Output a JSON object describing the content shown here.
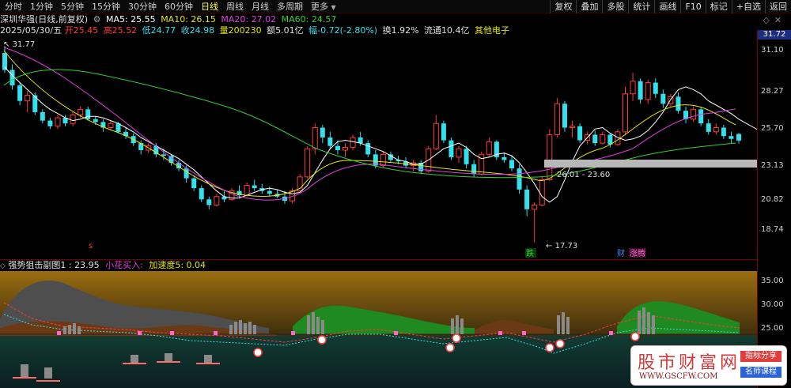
{
  "toolbar": {
    "periods": [
      "分时",
      "1分钟",
      "5分钟",
      "15分钟",
      "30分钟",
      "60分钟",
      "日线",
      "周线",
      "月线",
      "多周期",
      "更多"
    ],
    "active_period": "日线",
    "tools": [
      "复权",
      "叠加",
      "多股",
      "统计",
      "画线",
      "F10",
      "标记",
      "+自选",
      "返回"
    ]
  },
  "stock": {
    "name": "深圳华强(日线,前复权)",
    "date": "2025/05/30/五",
    "open": "开25.45",
    "high": "高25.52",
    "low": "低24.77",
    "close": "收24.98",
    "volume": "量200230",
    "amount": "额5.01亿",
    "change": "幅-0.72(-2.80%)",
    "turnover": "换1.92%",
    "float_cap": "流通10.4亿",
    "sector": "其他电子"
  },
  "ma": {
    "ma5": "MA5: 25.55",
    "ma10": "MA10: 26.15",
    "ma20": "MA20: 27.02",
    "ma60": "MA60: 24.57"
  },
  "colors": {
    "up": "#ff3a3a",
    "down": "#33e0ee",
    "ma5": "#ffffff",
    "ma10": "#e6e600",
    "ma20": "#e040e0",
    "ma60": "#33d033",
    "axis": "#7a0000"
  },
  "price_axis": {
    "badge": "31.72",
    "ticks": [
      "31.10",
      "28.27",
      "25.70",
      "23.13",
      "20.82",
      "18.74"
    ]
  },
  "annotations": {
    "high_label": "31.77",
    "low_label": "17.73",
    "range_label": "26.01 - 23.60",
    "tag_die": "跌",
    "tag_cai": "财",
    "tag_zhangteng": "涨腾",
    "tag_s": "s"
  },
  "sub_panel": {
    "title": "强势狙击副图1",
    "value": ": 23.95",
    "xiaohua": "小花买入:",
    "accel": "加速度5: 0.04",
    "ticks": [
      "35.00",
      "30.00",
      "25.00"
    ]
  },
  "watermark": {
    "title": "股市财富网",
    "url": "WWW.GSCFW.COM",
    "tag1": "指标分享",
    "tag2": "名师课程"
  },
  "chart_data": {
    "type": "candlestick",
    "y_range": [
      17.0,
      32.5
    ],
    "y_ticks": [
      31.1,
      28.27,
      25.7,
      23.13,
      20.82,
      18.74
    ],
    "candles": [
      [
        31.2,
        31.7,
        29.8,
        30.0
      ],
      [
        30.0,
        30.4,
        28.6,
        28.9
      ],
      [
        28.9,
        29.1,
        27.5,
        27.8
      ],
      [
        27.8,
        28.5,
        27.0,
        28.2
      ],
      [
        28.2,
        28.4,
        26.8,
        27.0
      ],
      [
        27.0,
        27.2,
        26.2,
        26.4
      ],
      [
        26.4,
        26.6,
        25.8,
        26.0
      ],
      [
        26.0,
        26.8,
        25.8,
        26.6
      ],
      [
        26.6,
        26.8,
        26.0,
        26.2
      ],
      [
        26.2,
        27.0,
        26.0,
        26.8
      ],
      [
        26.8,
        27.4,
        26.6,
        27.2
      ],
      [
        27.2,
        27.4,
        26.4,
        26.5
      ],
      [
        26.5,
        26.7,
        26.1,
        26.3
      ],
      [
        26.3,
        26.5,
        25.6,
        25.9
      ],
      [
        25.9,
        26.4,
        25.7,
        26.2
      ],
      [
        26.2,
        26.3,
        25.5,
        25.6
      ],
      [
        25.6,
        25.9,
        25.1,
        25.3
      ],
      [
        25.3,
        25.5,
        24.6,
        24.8
      ],
      [
        24.8,
        25.0,
        24.0,
        24.3
      ],
      [
        24.3,
        24.8,
        24.1,
        24.6
      ],
      [
        24.6,
        24.8,
        23.8,
        24.0
      ],
      [
        24.0,
        24.4,
        23.6,
        23.9
      ],
      [
        23.9,
        24.0,
        23.2,
        23.4
      ],
      [
        23.4,
        23.6,
        22.8,
        23.0
      ],
      [
        23.0,
        23.2,
        22.0,
        22.3
      ],
      [
        22.3,
        22.5,
        21.4,
        21.6
      ],
      [
        21.6,
        21.8,
        20.6,
        20.8
      ],
      [
        20.8,
        21.0,
        20.1,
        20.4
      ],
      [
        20.4,
        21.2,
        20.3,
        21.0
      ],
      [
        21.0,
        21.4,
        20.6,
        20.8
      ],
      [
        20.8,
        21.6,
        20.7,
        21.4
      ],
      [
        21.4,
        21.8,
        20.9,
        21.1
      ],
      [
        21.1,
        22.0,
        21.0,
        21.8
      ],
      [
        21.8,
        22.2,
        21.4,
        21.6
      ],
      [
        21.6,
        21.9,
        21.2,
        21.4
      ],
      [
        21.4,
        21.7,
        21.0,
        21.2
      ],
      [
        21.2,
        21.5,
        20.9,
        21.0
      ],
      [
        21.0,
        21.4,
        20.5,
        20.7
      ],
      [
        20.7,
        21.6,
        20.5,
        21.4
      ],
      [
        21.4,
        22.6,
        21.3,
        22.4
      ],
      [
        22.4,
        24.6,
        22.3,
        24.4
      ],
      [
        24.4,
        26.2,
        24.0,
        25.9
      ],
      [
        25.9,
        26.1,
        24.8,
        25.2
      ],
      [
        25.2,
        25.6,
        24.4,
        24.6
      ],
      [
        24.6,
        25.0,
        24.0,
        24.3
      ],
      [
        24.3,
        24.8,
        23.8,
        24.5
      ],
      [
        24.5,
        25.4,
        24.3,
        25.2
      ],
      [
        25.2,
        25.6,
        24.6,
        24.8
      ],
      [
        24.8,
        25.0,
        23.8,
        24.0
      ],
      [
        24.0,
        24.3,
        23.0,
        23.2
      ],
      [
        23.2,
        24.2,
        23.1,
        24.0
      ],
      [
        24.0,
        24.2,
        23.4,
        23.6
      ],
      [
        23.6,
        23.9,
        23.3,
        23.5
      ],
      [
        23.5,
        23.8,
        23.0,
        23.2
      ],
      [
        23.2,
        23.6,
        22.8,
        23.4
      ],
      [
        23.4,
        23.6,
        22.6,
        22.8
      ],
      [
        22.8,
        24.6,
        22.7,
        24.4
      ],
      [
        24.4,
        26.8,
        24.3,
        26.2
      ],
      [
        26.2,
        26.4,
        24.8,
        25.0
      ],
      [
        25.0,
        25.2,
        23.6,
        23.8
      ],
      [
        23.8,
        24.6,
        23.4,
        24.4
      ],
      [
        24.4,
        24.6,
        23.0,
        23.3
      ],
      [
        23.3,
        23.6,
        22.4,
        22.6
      ],
      [
        22.6,
        24.2,
        22.5,
        24.0
      ],
      [
        24.0,
        25.2,
        23.8,
        24.9
      ],
      [
        24.9,
        25.0,
        23.6,
        23.8
      ],
      [
        23.8,
        24.1,
        23.4,
        23.6
      ],
      [
        23.6,
        23.9,
        22.8,
        23.0
      ],
      [
        23.0,
        23.3,
        21.2,
        21.5
      ],
      [
        21.5,
        21.8,
        19.6,
        20.1
      ],
      [
        20.1,
        20.6,
        17.73,
        20.4
      ],
      [
        20.4,
        22.4,
        20.3,
        22.2
      ],
      [
        22.2,
        25.8,
        22.1,
        25.4
      ],
      [
        25.4,
        28.0,
        25.2,
        27.6
      ],
      [
        27.6,
        27.8,
        25.6,
        25.9
      ],
      [
        25.9,
        26.4,
        25.2,
        26.0
      ],
      [
        26.0,
        26.2,
        24.8,
        25.0
      ],
      [
        25.0,
        25.6,
        24.7,
        25.4
      ],
      [
        25.4,
        25.7,
        24.6,
        24.8
      ],
      [
        24.8,
        25.6,
        24.7,
        25.4
      ],
      [
        25.4,
        25.5,
        24.5,
        24.7
      ],
      [
        24.7,
        25.8,
        24.6,
        25.6
      ],
      [
        25.6,
        28.8,
        25.4,
        28.3
      ],
      [
        28.3,
        29.8,
        27.8,
        29.2
      ],
      [
        29.2,
        29.4,
        27.6,
        27.9
      ],
      [
        27.9,
        29.3,
        27.6,
        29.1
      ],
      [
        29.1,
        29.4,
        28.0,
        28.3
      ],
      [
        28.3,
        28.6,
        27.3,
        27.6
      ],
      [
        27.6,
        28.3,
        27.4,
        28.1
      ],
      [
        28.1,
        28.4,
        26.9,
        27.1
      ],
      [
        27.1,
        27.4,
        26.2,
        26.5
      ],
      [
        26.5,
        27.4,
        26.3,
        27.2
      ],
      [
        27.2,
        27.4,
        26.0,
        26.2
      ],
      [
        26.2,
        26.5,
        25.4,
        25.6
      ],
      [
        25.6,
        26.2,
        25.4,
        25.9
      ],
      [
        25.9,
        26.1,
        25.1,
        25.3
      ],
      [
        25.3,
        25.6,
        24.8,
        25.1
      ],
      [
        25.45,
        25.52,
        24.77,
        24.98
      ]
    ],
    "ma5": [
      30.2,
      29.6,
      29.1,
      28.6,
      28.1,
      27.6,
      27.2,
      26.9,
      26.6,
      26.4,
      26.5,
      26.7,
      26.7,
      26.6,
      26.4,
      26.2,
      25.9,
      25.6,
      25.2,
      24.9,
      24.6,
      24.3,
      24.0,
      23.7,
      23.3,
      22.9,
      22.4,
      21.9,
      21.4,
      21.0,
      20.9,
      20.9,
      21.1,
      21.3,
      21.5,
      21.6,
      21.5,
      21.3,
      21.2,
      21.3,
      21.8,
      22.7,
      23.6,
      24.4,
      24.9,
      25.0,
      24.9,
      24.8,
      24.6,
      24.4,
      24.2,
      23.9,
      23.6,
      23.5,
      23.3,
      23.3,
      23.6,
      24.0,
      24.4,
      24.6,
      24.8,
      24.5,
      24.0,
      23.7,
      23.8,
      24.0,
      24.1,
      23.9,
      23.4,
      22.7,
      21.9,
      21.0,
      20.6,
      21.0,
      22.2,
      23.5,
      24.6,
      25.2,
      25.8,
      25.9,
      25.5,
      25.2,
      25.0,
      25.1,
      25.3,
      25.7,
      26.3,
      27.0,
      27.9,
      28.6,
      28.8,
      28.6,
      28.3,
      27.8,
      27.5,
      27.2,
      26.9,
      26.5,
      26.2,
      25.9,
      25.6
    ]
  }
}
